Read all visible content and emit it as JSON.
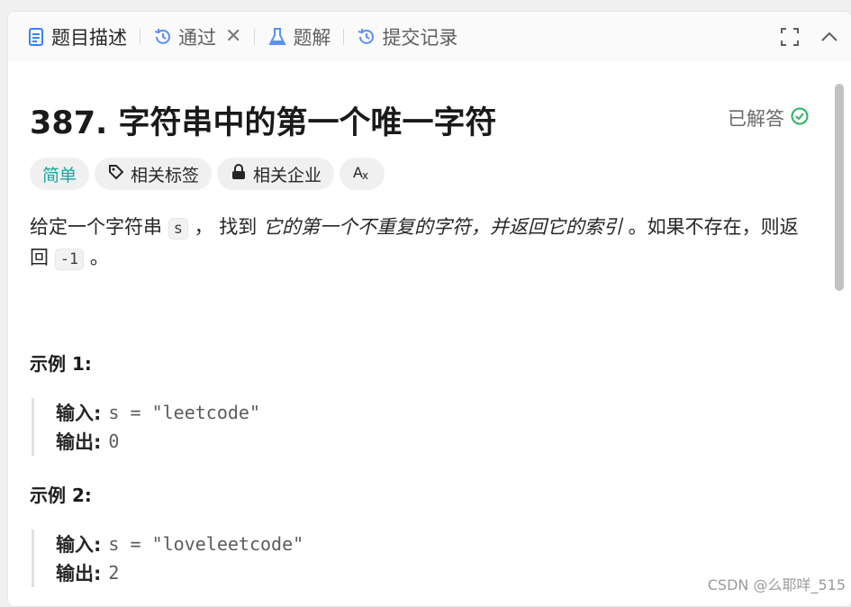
{
  "tabs": [
    {
      "label": "题目描述",
      "icon": "description-icon"
    },
    {
      "label": "通过",
      "icon": "history-icon"
    },
    {
      "label": "题解",
      "icon": "flask-icon"
    },
    {
      "label": "提交记录",
      "icon": "history-icon"
    }
  ],
  "problem": {
    "title": "387. 字符串中的第一个唯一字符",
    "status": "已解答",
    "tags": [
      "简单",
      "相关标签",
      "相关企业"
    ],
    "description": {
      "part1": "给定一个字符串 ",
      "code_s": "s",
      "part2": " ， 找到 ",
      "emphasis": "它的第一个不重复的字符，并返回它的索引",
      "part3": " 。如果不存在，则返回 ",
      "code_neg": "-1",
      "part4": " 。"
    }
  },
  "examples": [
    {
      "title": "示例 1:",
      "input_label": "输入:",
      "input_value": "s = \"leetcode\"",
      "output_label": "输出:",
      "output_value": "0"
    },
    {
      "title": "示例 2:",
      "input_label": "输入:",
      "input_value": "s = \"loveleetcode\"",
      "output_label": "输出:",
      "output_value": "2"
    }
  ],
  "watermark": "CSDN @么耶咩_515",
  "colors": {
    "easy": "#1aa4a0",
    "solved": "#2db55d",
    "tab_icon": "#5b8ff9",
    "active_icon": "#3b82f6"
  }
}
